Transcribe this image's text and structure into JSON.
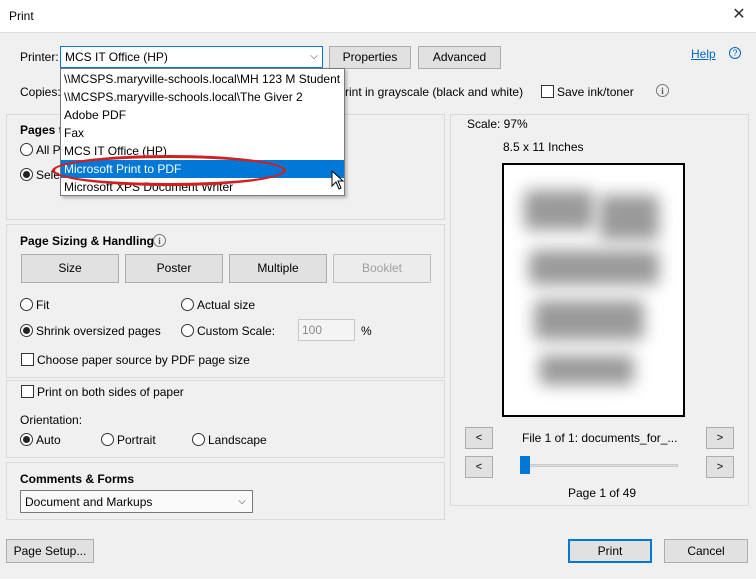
{
  "window": {
    "title": "Print",
    "close_glyph": "✕"
  },
  "printer": {
    "label": "Printer:",
    "selected": "MCS IT Office (HP)",
    "properties_label": "Properties",
    "advanced_label": "Advanced",
    "help_label": "Help",
    "options": [
      "\\\\MCSPS.maryville-schools.local\\MH 123 M Student",
      "\\\\MCSPS.maryville-schools.local\\The Giver 2",
      "Adobe PDF",
      "Fax",
      "MCS IT Office (HP)",
      "Microsoft Print to PDF",
      "Microsoft XPS Document Writer"
    ],
    "highlighted_option": "Microsoft Print to PDF"
  },
  "copies": {
    "label": "Copies:",
    "grayscale_label": "rint in grayscale (black and white)",
    "save_ink_label": "Save ink/toner"
  },
  "pages": {
    "title_fragment": "Pages t",
    "all_fragment": "All P",
    "select_fragment": "Sele"
  },
  "sizing": {
    "title": "Page Sizing & Handling",
    "tabs": [
      "Size",
      "Poster",
      "Multiple",
      "Booklet"
    ],
    "fit_label": "Fit",
    "actual_size_label": "Actual size",
    "shrink_label": "Shrink oversized pages",
    "custom_scale_label": "Custom Scale:",
    "custom_scale_value": "100",
    "percent": "%",
    "paper_source_label": "Choose paper source by PDF page size"
  },
  "duplex": {
    "label": "Print on both sides of paper"
  },
  "orientation": {
    "title": "Orientation:",
    "auto": "Auto",
    "portrait": "Portrait",
    "landscape": "Landscape"
  },
  "comments": {
    "title": "Comments & Forms",
    "selected": "Document and Markups"
  },
  "preview": {
    "scale": "Scale:  97%",
    "paper": "8.5 x 11 Inches",
    "file_label": "File 1 of 1: documents_for_...",
    "page_label": "Page 1 of 49",
    "prev": "<",
    "next": ">",
    "page_position": 0.0
  },
  "footer": {
    "page_setup": "Page Setup...",
    "print": "Print",
    "cancel": "Cancel"
  },
  "colors": {
    "accent": "#0078d7",
    "highlight_ellipse": "#d22020",
    "link": "#0066cc"
  }
}
